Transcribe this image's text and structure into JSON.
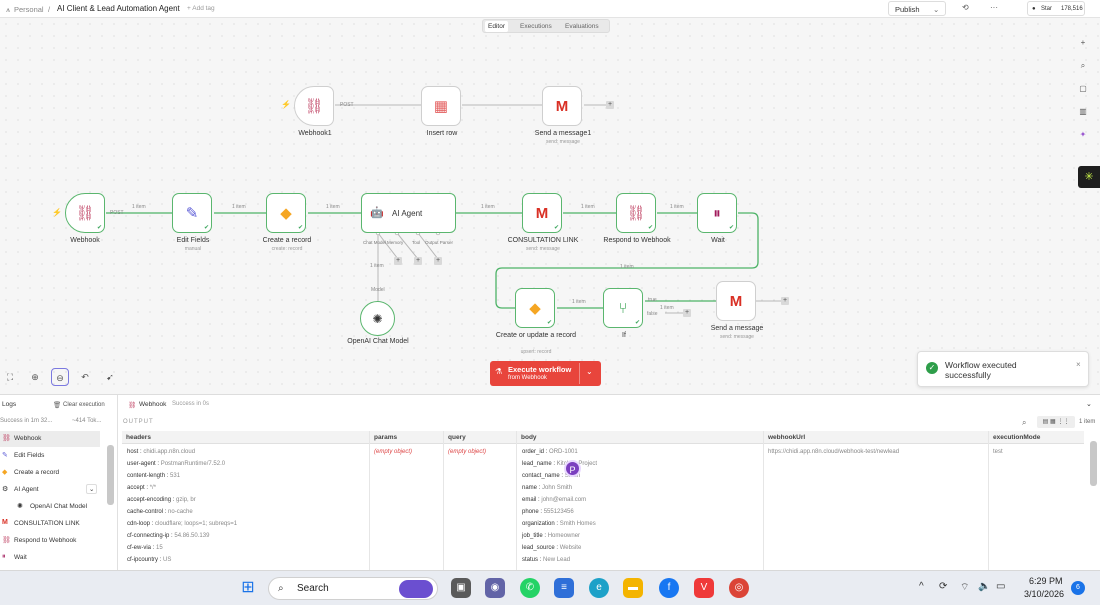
{
  "topbar": {
    "workspace": "Personal",
    "separator": "/",
    "workflow_name": "AI Client & Lead Automation Agent",
    "add_tag": "+ Add tag",
    "publish": "Publish",
    "github_star": "Star",
    "star_count": "178,516"
  },
  "tabs": [
    "Editor",
    "Executions",
    "Evaluations"
  ],
  "nodes": {
    "webhook1": {
      "label": "Webhook1",
      "port": "POST"
    },
    "insert_row": {
      "label": "Insert row"
    },
    "send_message1": {
      "label": "Send a message1",
      "sub": "send: message"
    },
    "webhook": {
      "label": "Webhook",
      "port": "POST"
    },
    "edit_fields": {
      "label": "Edit Fields",
      "sub": "manual"
    },
    "create_record": {
      "label": "Create a record",
      "sub": "create: record"
    },
    "ai_agent": {
      "label": "AI Agent",
      "ports": [
        "Chat Model",
        "Memory",
        "Tool",
        "Output Parser"
      ]
    },
    "consultation": {
      "label": "CONSULTATION LINK",
      "sub": "send: message"
    },
    "respond": {
      "label": "Respond to Webhook"
    },
    "wait": {
      "label": "Wait"
    },
    "create_update": {
      "label": "Create or update a record",
      "sub": "upsert: record"
    },
    "if": {
      "label": "If",
      "true": "true",
      "false": "false"
    },
    "send_message": {
      "label": "Send a message",
      "sub": "send: message"
    },
    "openai": {
      "label": "OpenAI Chat Model",
      "port": "Model"
    }
  },
  "edges": {
    "one_item": "1 item"
  },
  "execute": {
    "label": "Execute workflow",
    "sub": "from Webhook"
  },
  "toast": {
    "message": "Workflow executed successfully"
  },
  "logs": {
    "title": "Logs",
    "clear": "Clear execution",
    "summary": "Success in 1m 32...",
    "tokens": "~414 Tok...",
    "items": [
      {
        "label": "Webhook",
        "icon": "webhook-icon"
      },
      {
        "label": "Edit Fields",
        "icon": "pencil-icon"
      },
      {
        "label": "Create a record",
        "icon": "airtable-icon"
      },
      {
        "label": "AI Agent",
        "icon": "robot-icon"
      },
      {
        "label": "OpenAI Chat Model",
        "icon": "openai-icon"
      },
      {
        "label": "CONSULTATION LINK",
        "icon": "gmail-icon"
      },
      {
        "label": "Respond to Webhook",
        "icon": "webhook-icon"
      },
      {
        "label": "Wait",
        "icon": "pause-icon"
      }
    ]
  },
  "output": {
    "node": "Webhook",
    "status": "Success in 0s",
    "label": "OUTPUT",
    "items_count": "1 item",
    "columns": [
      "headers",
      "params",
      "query",
      "body",
      "webhookUrl",
      "executionMode"
    ],
    "headers": [
      [
        "host",
        "chidi.app.n8n.cloud"
      ],
      [
        "user-agent",
        "PostmanRuntime/7.52.0"
      ],
      [
        "content-length",
        "531"
      ],
      [
        "accept",
        "*/*"
      ],
      [
        "accept-encoding",
        "gzip, br"
      ],
      [
        "cache-control",
        "no-cache"
      ],
      [
        "cdn-loop",
        "cloudflare; loops=1; subreqs=1"
      ],
      [
        "cf-connecting-ip",
        "54.86.50.139"
      ],
      [
        "cf-ew-via",
        "15"
      ],
      [
        "cf-ipcountry",
        "US"
      ]
    ],
    "params": "(empty object)",
    "query": "(empty object)",
    "body": [
      [
        "order_id",
        "ORD-1001"
      ],
      [
        "lead_name",
        "Kitchen Project"
      ],
      [
        "contact_name",
        "Smith"
      ],
      [
        "name",
        "John Smith"
      ],
      [
        "email",
        "john@email.com"
      ],
      [
        "phone",
        "555123456"
      ],
      [
        "organization",
        "Smith Homes"
      ],
      [
        "job_title",
        "Homeowner"
      ],
      [
        "lead_source",
        "Website"
      ],
      [
        "status",
        "New Lead"
      ]
    ],
    "webhookUrl": "https://chidi.app.n8n.cloud/webhook-test/newlead",
    "executionMode": "test"
  },
  "taskbar": {
    "search": "Search",
    "time": "6:29 PM",
    "date": "3/10/2026",
    "notif": "6"
  }
}
